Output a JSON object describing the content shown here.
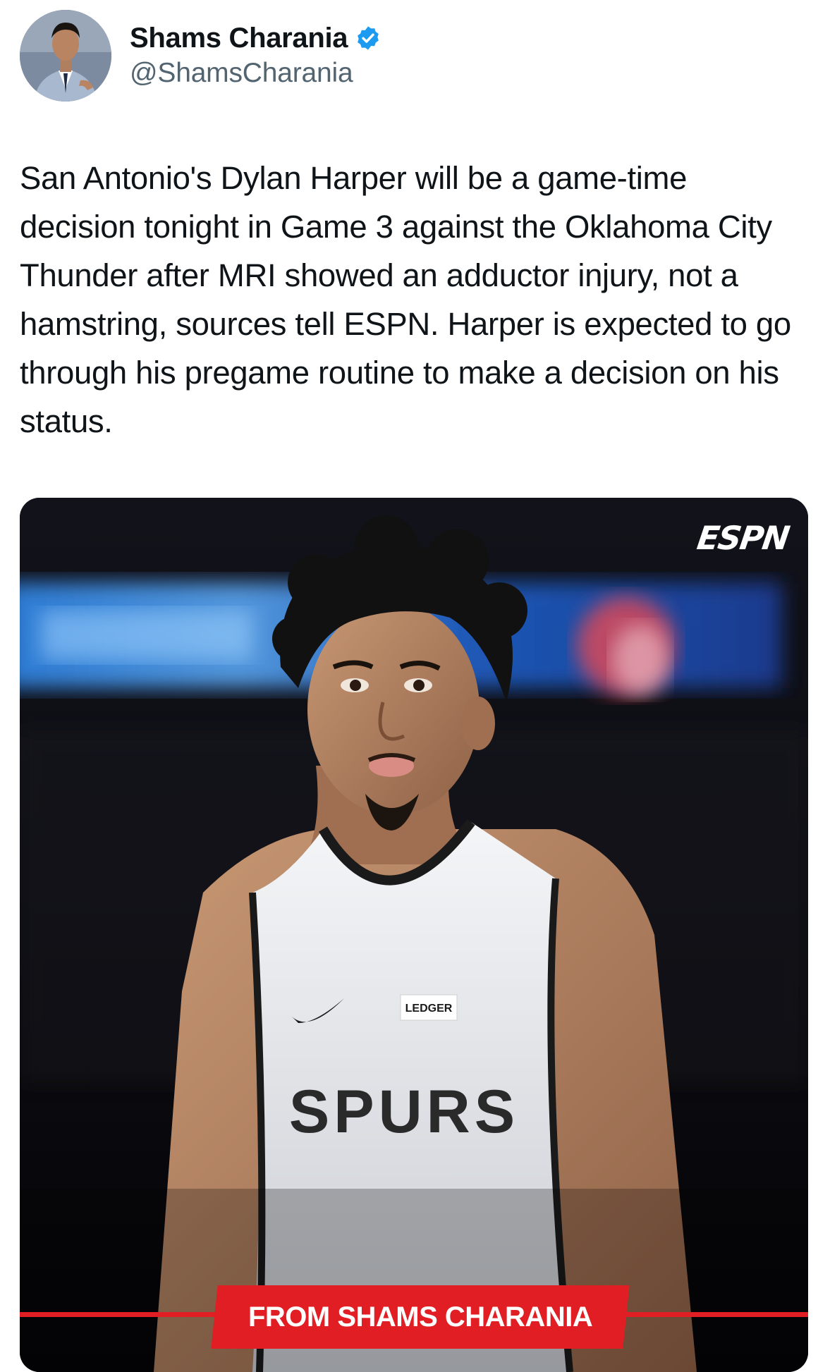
{
  "author": {
    "display_name": "Shams Charania",
    "handle": "@ShamsCharania",
    "verified_icon": "verified-badge-icon",
    "verified_color": "#1d9bf0"
  },
  "tweet": {
    "text": "San Antonio's Dylan Harper will be a game-time decision tonight in Game 3 against the Oklahoma City Thunder after MRI showed an adductor injury, not a hamstring, sources tell ESPN. Harper is expected to go through his pregame routine to make a decision on his status."
  },
  "media": {
    "logo": "ESPN",
    "banner_text": "FROM SHAMS CHARANIA",
    "banner_color": "#e01e24",
    "jersey_team": "SPURS",
    "jersey_sponsor": "LEDGER"
  },
  "colors": {
    "text_primary": "#0f1419",
    "text_secondary": "#536471"
  }
}
